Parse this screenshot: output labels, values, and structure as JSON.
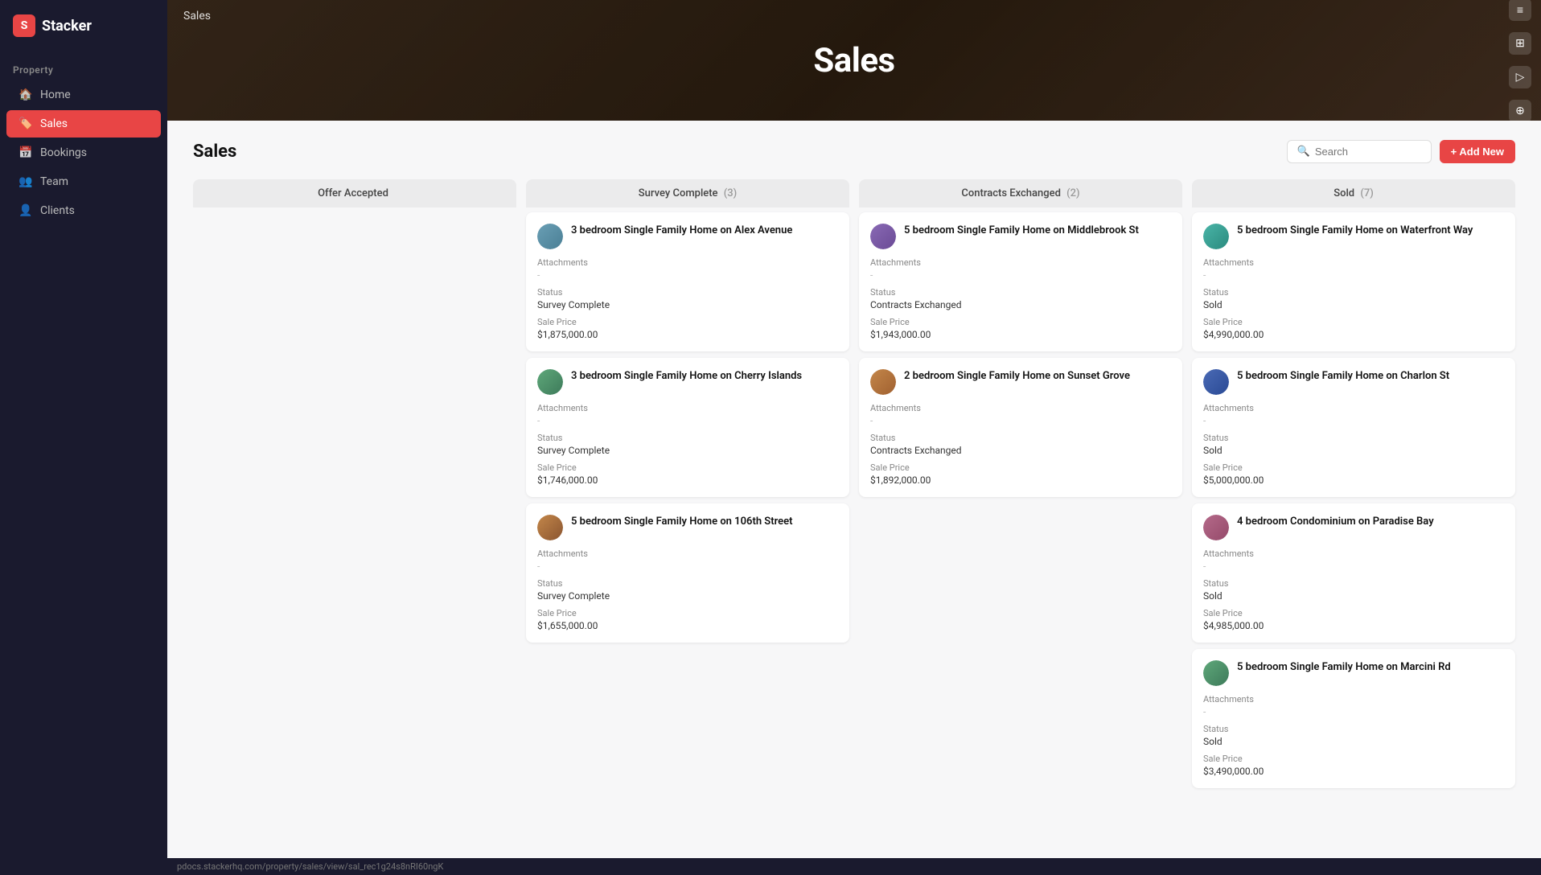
{
  "sidebar": {
    "logo_text": "Stacker",
    "section_label": "Property",
    "items": [
      {
        "id": "home",
        "label": "Home",
        "icon": "🏠",
        "active": false
      },
      {
        "id": "sales",
        "label": "Sales",
        "icon": "🏷️",
        "active": true
      },
      {
        "id": "bookings",
        "label": "Bookings",
        "icon": "📅",
        "active": false
      },
      {
        "id": "team",
        "label": "Team",
        "icon": "👥",
        "active": false
      },
      {
        "id": "clients",
        "label": "Clients",
        "icon": "👤",
        "active": false
      }
    ]
  },
  "hero": {
    "nav_item": "Sales",
    "title": "Sales"
  },
  "board": {
    "title": "Sales",
    "search_placeholder": "Search",
    "add_new_label": "+ Add New",
    "columns": [
      {
        "id": "offer-accepted",
        "label": "Offer Accepted",
        "count": "",
        "cards": []
      },
      {
        "id": "survey-complete",
        "label": "Survey Complete",
        "count": "(3)",
        "cards": [
          {
            "id": "sc1",
            "title": "3 bedroom Single Family Home on Alex Avenue",
            "avatar_class": "blue",
            "attachments_label": "Attachments",
            "attachments_value": "-",
            "status_label": "Status",
            "status_value": "Survey Complete",
            "price_label": "Sale Price",
            "price_value": "$1,875,000.00"
          },
          {
            "id": "sc2",
            "title": "3 bedroom Single Family Home on Cherry Islands",
            "avatar_class": "green",
            "attachments_label": "Attachments",
            "attachments_value": "-",
            "status_label": "Status",
            "status_value": "Survey Complete",
            "price_label": "Sale Price",
            "price_value": "$1,746,000.00"
          },
          {
            "id": "sc3",
            "title": "5 bedroom Single Family Home on 106th Street",
            "avatar_class": "brown",
            "attachments_label": "Attachments",
            "attachments_value": "-",
            "status_label": "Status",
            "status_value": "Survey Complete",
            "price_label": "Sale Price",
            "price_value": "$1,655,000.00"
          }
        ]
      },
      {
        "id": "contracts-exchanged",
        "label": "Contracts Exchanged",
        "count": "(2)",
        "cards": [
          {
            "id": "ce1",
            "title": "5 bedroom Single Family Home on Middlebrook St",
            "avatar_class": "purple",
            "attachments_label": "Attachments",
            "attachments_value": "-",
            "status_label": "Status",
            "status_value": "Contracts Exchanged",
            "price_label": "Sale Price",
            "price_value": "$1,943,000.00"
          },
          {
            "id": "ce2",
            "title": "2 bedroom Single Family Home on Sunset Grove",
            "avatar_class": "orange",
            "attachments_label": "Attachments",
            "attachments_value": "-",
            "status_label": "Status",
            "status_value": "Contracts Exchanged",
            "price_label": "Sale Price",
            "price_value": "$1,892,000.00"
          }
        ]
      },
      {
        "id": "sold",
        "label": "Sold",
        "count": "(7)",
        "cards": [
          {
            "id": "s1",
            "title": "5 bedroom Single Family Home on Waterfront Way",
            "avatar_class": "teal",
            "attachments_label": "Attachments",
            "attachments_value": "-",
            "status_label": "Status",
            "status_value": "Sold",
            "price_label": "Sale Price",
            "price_value": "$4,990,000.00"
          },
          {
            "id": "s2",
            "title": "5 bedroom Single Family Home on Charlon St",
            "avatar_class": "navy",
            "attachments_label": "Attachments",
            "attachments_value": "-",
            "status_label": "Status",
            "status_value": "Sold",
            "price_label": "Sale Price",
            "price_value": "$5,000,000.00"
          },
          {
            "id": "s3",
            "title": "4 bedroom Condominium on Paradise Bay",
            "avatar_class": "rose",
            "attachments_label": "Attachments",
            "attachments_value": "-",
            "status_label": "Status",
            "status_value": "Sold",
            "price_label": "Sale Price",
            "price_value": "$4,985,000.00"
          },
          {
            "id": "s4",
            "title": "5 bedroom Single Family Home on Marcini Rd",
            "avatar_class": "green",
            "attachments_label": "Attachments",
            "attachments_value": "-",
            "status_label": "Status",
            "status_value": "Sold",
            "price_label": "Sale Price",
            "price_value": "$3,490,000.00"
          }
        ]
      }
    ]
  },
  "status_bar": {
    "url": "pdocs.stackerhq.com/property/sales/view/sal_rec1g24s8nRI60ngK"
  },
  "right_icons": [
    "≡",
    "⊞",
    "▷",
    "⊕"
  ]
}
